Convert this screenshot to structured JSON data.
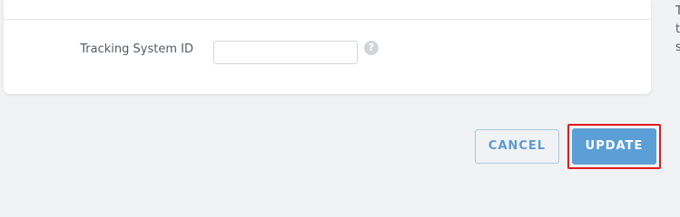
{
  "form": {
    "field_label": "Tracking System ID",
    "field_value": "",
    "help_icon_glyph": "?"
  },
  "side_text": [
    "T",
    "t",
    "s"
  ],
  "buttons": {
    "cancel_label": "CANCEL",
    "update_label": "UPDATE"
  },
  "colors": {
    "background": "#f1f2f4",
    "primary": "#5b9fd6",
    "highlight_border": "#e01b1b"
  }
}
